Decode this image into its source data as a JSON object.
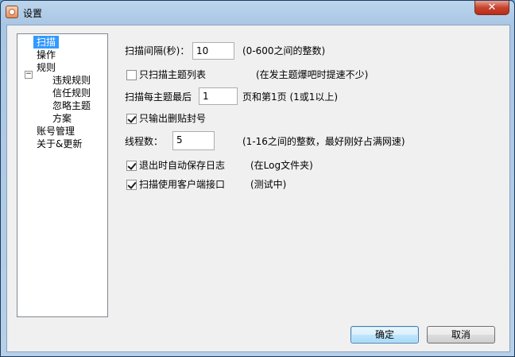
{
  "window": {
    "title": "设置",
    "close_glyph": "✕"
  },
  "tree": {
    "items": [
      {
        "label": "扫描",
        "level": 0,
        "selected": true
      },
      {
        "label": "操作",
        "level": 0
      },
      {
        "label": "规则",
        "level": 0,
        "expanded": true,
        "expander": "⊟"
      },
      {
        "label": "违规规则",
        "level": 1
      },
      {
        "label": "信任规则",
        "level": 1
      },
      {
        "label": "忽略主题",
        "level": 1
      },
      {
        "label": "方案",
        "level": 1
      },
      {
        "label": "账号管理",
        "level": 0
      },
      {
        "label": "关于&更新",
        "level": 0
      }
    ]
  },
  "settings": {
    "scan_interval": {
      "label": "扫描间隔(秒)：",
      "value": "10",
      "hint": "(0-600之间的整数)"
    },
    "only_topic_list": {
      "label": "只扫描主题列表",
      "checked": false,
      "hint": "(在发主题爆吧时提速不少)"
    },
    "last_page": {
      "label": "扫描每主题最后",
      "value": "1",
      "hint": "页和第1页 (1或1以上)"
    },
    "output_deleted": {
      "label": "只输出删贴封号",
      "checked": true
    },
    "threads": {
      "label": "线程数：",
      "value": "5",
      "hint": "(1-16之间的整数，最好刚好占满网速)"
    },
    "auto_save_log": {
      "label": "退出时自动保存日志",
      "checked": true,
      "hint": "(在Log文件夹)"
    },
    "client_api": {
      "label": "扫描使用客户端接口",
      "checked": true,
      "hint": "(测试中)"
    }
  },
  "buttons": {
    "ok": "确定",
    "cancel": "取消"
  }
}
